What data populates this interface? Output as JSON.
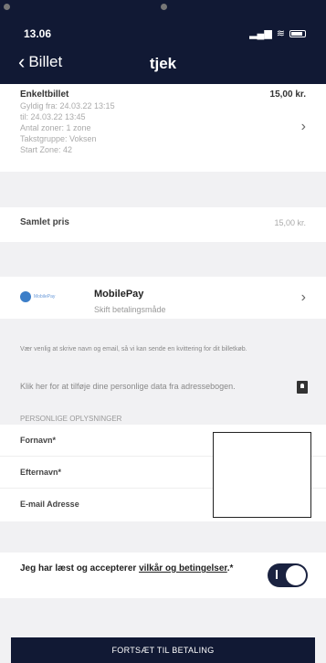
{
  "status": {
    "time": "13.06"
  },
  "nav": {
    "back_label": "Billet",
    "title": "tjek"
  },
  "ticket": {
    "name": "Enkeltbillet",
    "price": "15,00 kr.",
    "lines": [
      "Gyldig fra: 24.03.22 13:15",
      "til: 24.03.22 13:45",
      "Antal zoner: 1 zone",
      "Takstgruppe: Voksen",
      "Start Zone: 42"
    ]
  },
  "total": {
    "label": "Samlet pris",
    "value": "15,00 kr."
  },
  "payment": {
    "logo_text": "MobilePay",
    "name": "MobilePay",
    "subtitle": "Skift betalingsmåde"
  },
  "info": {
    "notice": "Vær venlig at skrive navn og email, så vi kan sende en kvittering for dit billetkøb.",
    "address_book": "Klik her for at tilføje dine personlige data fra adressebogen.",
    "section_title": "PERSONLIGE OPLYSNINGER"
  },
  "form": {
    "fields": [
      {
        "label": "Fornavn*"
      },
      {
        "label": "Efternavn*"
      },
      {
        "label": "E-mail Adresse"
      }
    ]
  },
  "terms": {
    "prefix": "Jeg har læst og accepterer ",
    "link": "vilkår og betingelser",
    "suffix": ".*",
    "accepted": true
  },
  "cta": {
    "label": "FORTSÆT TIL BETALING"
  }
}
